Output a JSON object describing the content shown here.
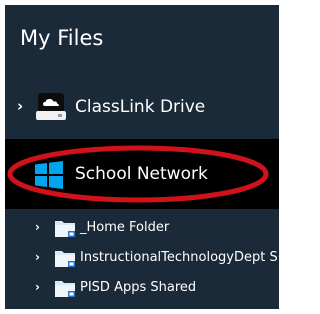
{
  "panel": {
    "title": "My Files",
    "background": "#1b2a39"
  },
  "drive": {
    "chevron": "›",
    "icon": "cloud-drive-icon",
    "label": "ClassLink Drive"
  },
  "network": {
    "icon": "windows-icon",
    "label": "School Network",
    "highlight_color": "#d0121b",
    "icon_color": "#00a4ef"
  },
  "folders": [
    {
      "chevron": "›",
      "icon": "network-folder-icon",
      "label": "_Home Folder"
    },
    {
      "chevron": "›",
      "icon": "network-folder-icon",
      "label": "InstructionalTechnologyDept S"
    },
    {
      "chevron": "›",
      "icon": "network-folder-icon",
      "label": "PISD Apps Shared"
    }
  ]
}
